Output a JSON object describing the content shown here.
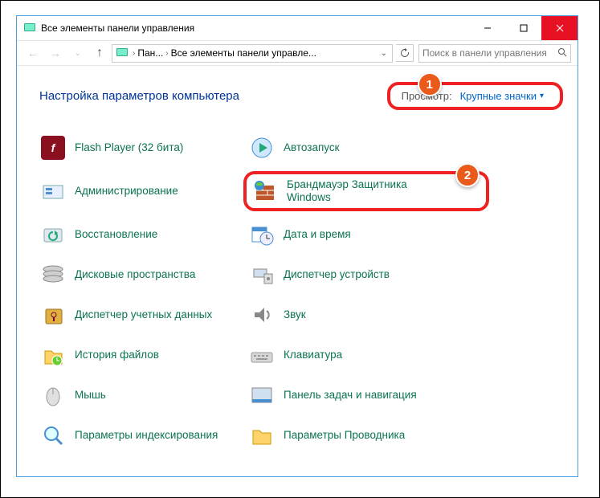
{
  "window": {
    "title": "Все элементы панели управления"
  },
  "breadcrumb": {
    "item1": "Пан...",
    "item2": "Все элементы панели управле..."
  },
  "search": {
    "placeholder": "Поиск в панели управления"
  },
  "page": {
    "title": "Настройка параметров компьютера"
  },
  "view": {
    "label": "Просмотр:",
    "value": "Крупные значки"
  },
  "callouts": {
    "one": "1",
    "two": "2"
  },
  "items": {
    "flash": "Flash Player (32 бита)",
    "autorun": "Автозапуск",
    "admin": "Администрирование",
    "firewall": "Брандмауэр Защитника Windows",
    "recovery": "Восстановление",
    "datetime": "Дата и время",
    "disks": "Дисковые пространства",
    "devices": "Диспетчер устройств",
    "credentials": "Диспетчер учетных данных",
    "sound": "Звук",
    "filehistory": "История файлов",
    "keyboard": "Клавиатура",
    "mouse": "Мышь",
    "taskbar": "Панель задач и навигация",
    "indexing": "Параметры индексирования",
    "explorer": "Параметры Проводника"
  }
}
